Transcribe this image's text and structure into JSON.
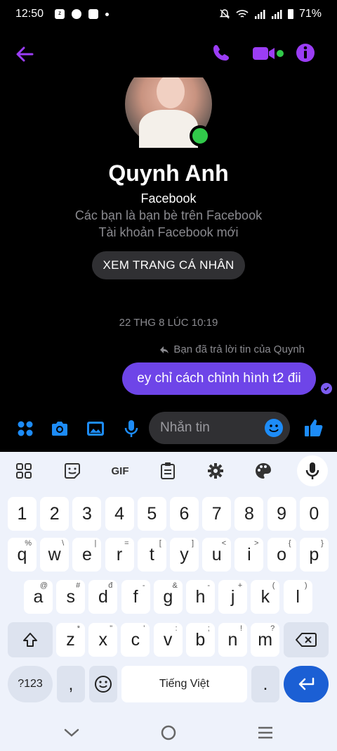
{
  "status": {
    "time": "12:50",
    "battery": "71%"
  },
  "profile": {
    "name": "Quynh Anh",
    "platform": "Facebook",
    "friends_note": "Các bạn là bạn bè trên Facebook",
    "new_account_note": "Tài khoản Facebook mới",
    "view_profile_label": "XEM TRANG CÁ NHÂN"
  },
  "conversation": {
    "timestamp": "22 THG 8 LÚC 10:19",
    "reply_note": "Bạn đã trả lời tin của Quynh",
    "message_text": "ey chỉ cách chỉnh hình t2 đii"
  },
  "composer": {
    "placeholder": "Nhắn tin"
  },
  "keyboard": {
    "toolbar": {
      "gif_label": "GIF"
    },
    "number_row": [
      "1",
      "2",
      "3",
      "4",
      "5",
      "6",
      "7",
      "8",
      "9",
      "0"
    ],
    "row1": [
      {
        "k": "q",
        "h": "%"
      },
      {
        "k": "w",
        "h": "\\"
      },
      {
        "k": "e",
        "h": "|"
      },
      {
        "k": "r",
        "h": "="
      },
      {
        "k": "t",
        "h": "["
      },
      {
        "k": "y",
        "h": "]"
      },
      {
        "k": "u",
        "h": "<"
      },
      {
        "k": "i",
        "h": ">"
      },
      {
        "k": "o",
        "h": "{"
      },
      {
        "k": "p",
        "h": "}"
      }
    ],
    "row2": [
      {
        "k": "a",
        "h": "@"
      },
      {
        "k": "s",
        "h": "#"
      },
      {
        "k": "d",
        "h": "đ"
      },
      {
        "k": "f",
        "h": "-"
      },
      {
        "k": "g",
        "h": "&"
      },
      {
        "k": "h",
        "h": "-"
      },
      {
        "k": "j",
        "h": "+"
      },
      {
        "k": "k",
        "h": "("
      },
      {
        "k": "l",
        "h": ")"
      }
    ],
    "row3": [
      {
        "k": "z",
        "h": "*"
      },
      {
        "k": "x",
        "h": "\""
      },
      {
        "k": "c",
        "h": "'"
      },
      {
        "k": "v",
        "h": ":"
      },
      {
        "k": "b",
        "h": ";"
      },
      {
        "k": "n",
        "h": "!"
      },
      {
        "k": "m",
        "h": "?"
      }
    ],
    "symbols_label": "?123",
    "comma_label": ",",
    "space_label": "Tiếng Việt",
    "period_label": "."
  }
}
